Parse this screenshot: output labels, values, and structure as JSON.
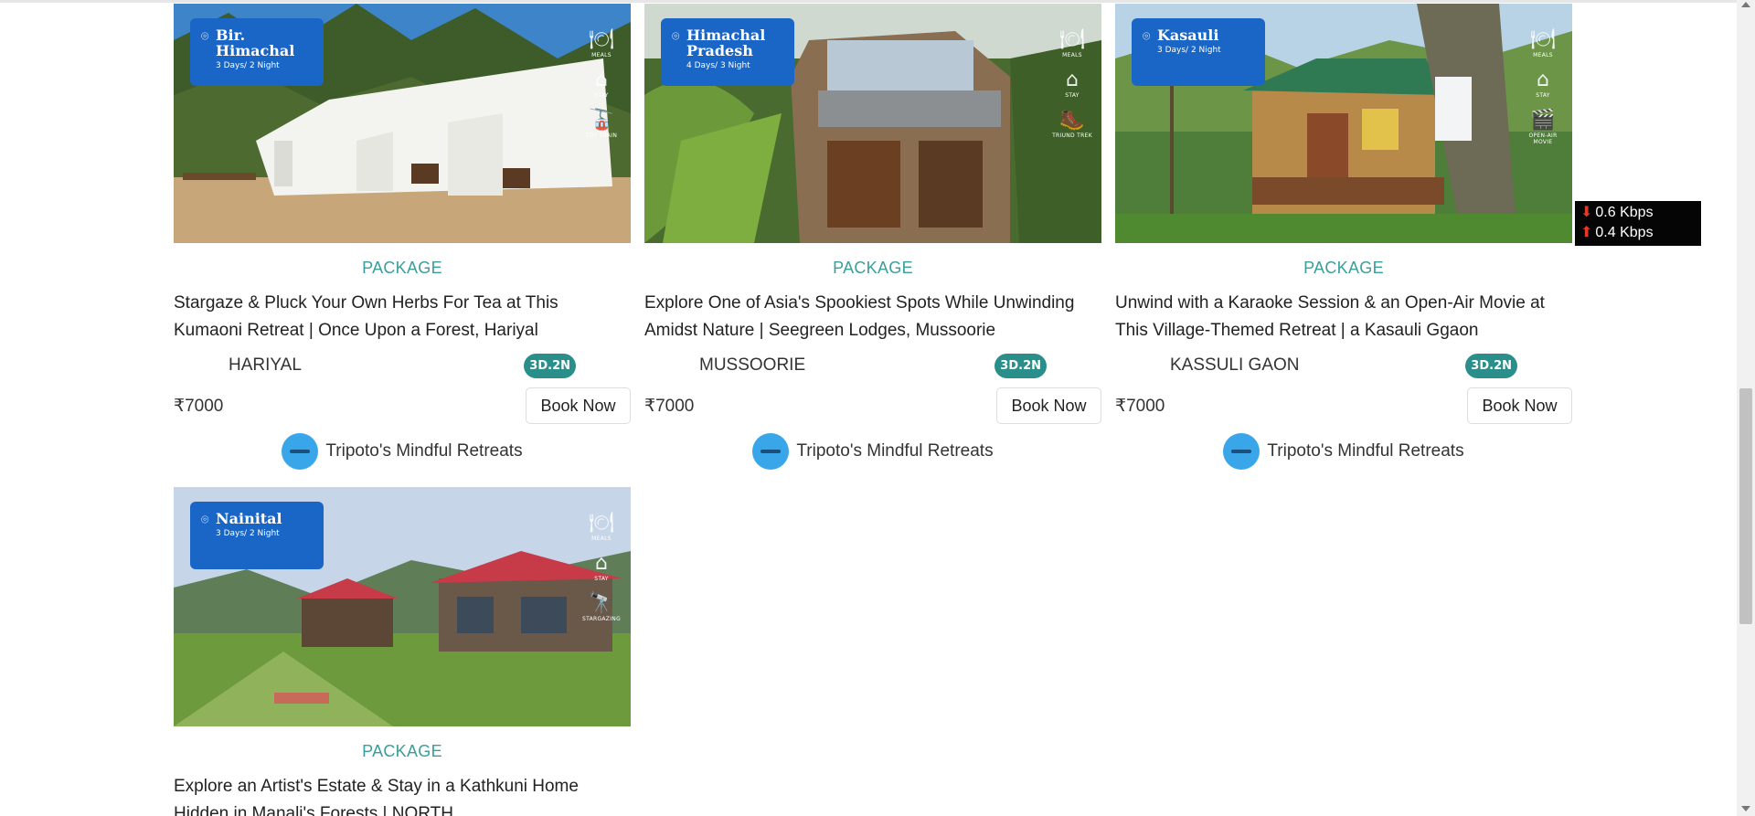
{
  "cards": [
    {
      "badge_place": "Bir. Himachal",
      "badge_days": "3 Days/ 2 Night",
      "amenities": [
        {
          "icon": "meals-icon",
          "label": "MEALS"
        },
        {
          "icon": "stay-icon",
          "label": "STAY"
        },
        {
          "icon": "toy-train-icon",
          "label": "TOY TRAIN"
        }
      ],
      "tag": "PACKAGE",
      "title": "Stargaze & Pluck Your Own Herbs For Tea at This Kumaoni Retreat | Once Upon a Forest, Hariyal",
      "city": "HARIYAL",
      "duration": "3D.2N",
      "price": "₹7000",
      "book_label": "Book Now",
      "host": "Tripoto's Mindful Retreats"
    },
    {
      "badge_place": "Himachal Pradesh",
      "badge_days": "4 Days/ 3 Night",
      "amenities": [
        {
          "icon": "meals-icon",
          "label": "MEALS"
        },
        {
          "icon": "stay-icon",
          "label": "STAY"
        },
        {
          "icon": "triund-trek-icon",
          "label": "TRIUND TREK"
        }
      ],
      "tag": "PACKAGE",
      "title": "Explore One of Asia's Spookiest Spots While Unwinding Amidst Nature | Seegreen Lodges, Mussoorie",
      "city": "MUSSOORIE",
      "duration": "3D.2N",
      "price": "₹7000",
      "book_label": "Book Now",
      "host": "Tripoto's Mindful Retreats"
    },
    {
      "badge_place": "Kasauli",
      "badge_days": "3 Days/ 2 Night",
      "amenities": [
        {
          "icon": "meals-icon",
          "label": "MEALS"
        },
        {
          "icon": "stay-icon",
          "label": "STAY"
        },
        {
          "icon": "open-air-movie-icon",
          "label": "OPEN-AIR MOVIE"
        }
      ],
      "tag": "PACKAGE",
      "title": "Unwind with a Karaoke Session & an Open-Air Movie at This Village-Themed Retreat | a Kasauli Ggaon",
      "city": "KASSULI GAON",
      "duration": "3D.2N",
      "price": "₹7000",
      "book_label": "Book Now",
      "host": "Tripoto's Mindful Retreats"
    },
    {
      "badge_place": "Nainital",
      "badge_days": "3 Days/ 2 Night",
      "amenities": [
        {
          "icon": "meals-icon",
          "label": "MEALS"
        },
        {
          "icon": "stay-icon",
          "label": "STAY"
        },
        {
          "icon": "stargazing-icon",
          "label": "STARGAZING"
        }
      ],
      "tag": "PACKAGE",
      "title": "Explore an Artist's Estate & Stay in a Kathkuni Home Hidden in Manali's Forests | NORTH"
    }
  ],
  "network_speed": {
    "down": "0.6 Kbps",
    "up": "0.4 Kbps",
    "accent_color": "#e03a2a"
  },
  "colors": {
    "tag": "#3a9e9a",
    "duration_badge": "#2a8f8b",
    "location_badge": "#1a66c7",
    "host_logo": "#3aa6ea"
  }
}
